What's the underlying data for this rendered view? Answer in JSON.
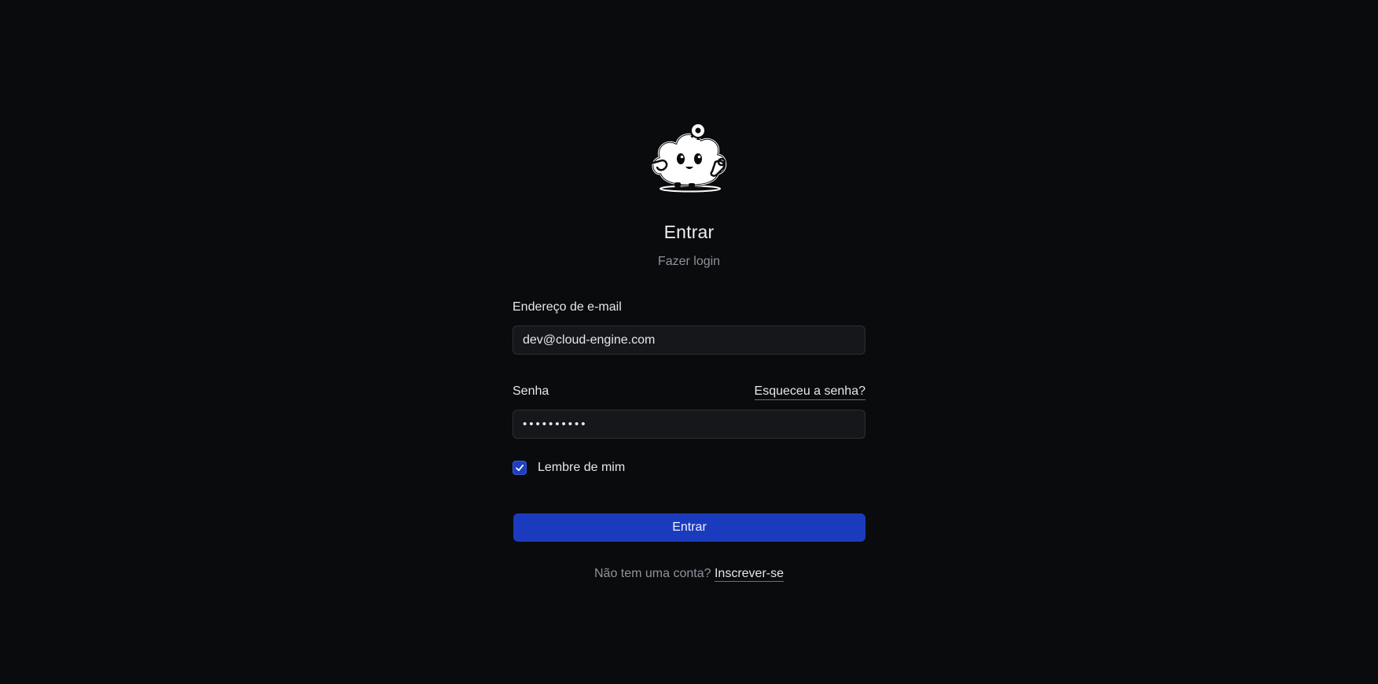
{
  "header": {
    "title": "Entrar",
    "subtitle": "Fazer login"
  },
  "logo": {
    "icon": "cloud-mascot-with-gear-icon"
  },
  "form": {
    "email": {
      "label": "Endereço de e-mail",
      "value": "dev@cloud-engine.com"
    },
    "password": {
      "label": "Senha",
      "value": "••••••••••",
      "forgot_link": "Esqueceu a senha?"
    },
    "remember": {
      "label": "Lembre de mim",
      "checked": true
    },
    "submit_label": "Entrar"
  },
  "footer": {
    "prompt": "Não tem uma conta?",
    "signup_link": "Inscrever-se"
  },
  "colors": {
    "background": "#0a0b0d",
    "accent": "#1b3bbf",
    "input_bg": "#15171b",
    "muted_text": "#8e939c"
  }
}
